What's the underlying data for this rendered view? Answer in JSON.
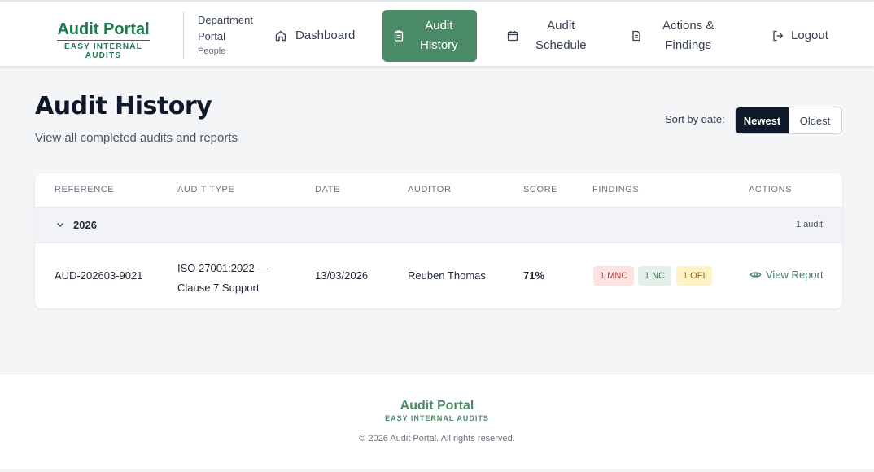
{
  "brand": {
    "title": "Audit Portal",
    "subtitle": "EASY INTERNAL AUDITS"
  },
  "department": {
    "line1": "Department",
    "line2": "Portal",
    "sub": "People"
  },
  "nav": {
    "dashboard": "Dashboard",
    "audit_history_1": "Audit",
    "audit_history_2": "History",
    "audit_schedule_1": "Audit",
    "audit_schedule_2": "Schedule",
    "actions_1": "Actions &",
    "actions_2": "Findings",
    "logout": "Logout"
  },
  "page": {
    "title": "Audit History",
    "subtitle": "View all completed audits and reports",
    "sort_label": "Sort by date:",
    "sort_options": [
      "Newest",
      "Oldest"
    ],
    "sort_selected": "Newest"
  },
  "table": {
    "headers": [
      "REFERENCE",
      "AUDIT TYPE",
      "DATE",
      "AUDITOR",
      "SCORE",
      "FINDINGS",
      "ACTIONS"
    ],
    "group": {
      "year": "2026",
      "count": "1 audit"
    },
    "rows": [
      {
        "reference": "AUD-202603-9021",
        "type_line1": "ISO 27001:2022 —",
        "type_line2": "Clause 7 Support",
        "date": "13/03/2026",
        "auditor": "Reuben Thomas",
        "score": "71%",
        "findings": [
          "1 MNC",
          "1 NC",
          "1 OFI"
        ],
        "action": "View Report"
      }
    ]
  },
  "footer": {
    "title": "Audit Portal",
    "subtitle": "EASY INTERNAL AUDITS",
    "copyright": "© 2026 Audit Portal. All rights reserved."
  },
  "colors": {
    "brand_green": "#1f7a4e",
    "active_nav": "#4a8a66",
    "mnc_bg": "#fde2e2",
    "nc_bg": "#e3efe8",
    "ofi_bg": "#fdf3c7"
  }
}
